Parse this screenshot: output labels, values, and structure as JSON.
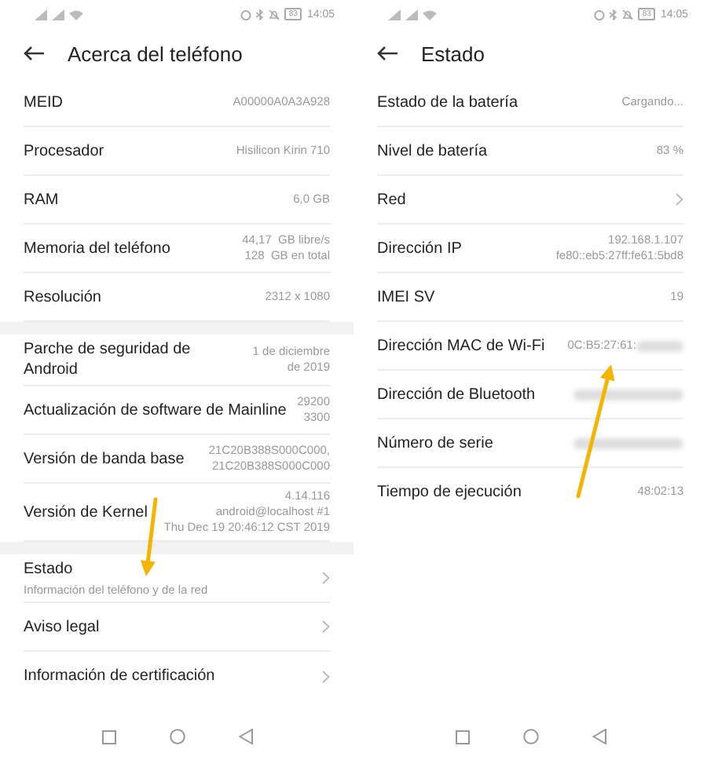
{
  "screens": [
    {
      "status_bar": {
        "battery": "83",
        "time": "14:05"
      },
      "title": "Acerca del teléfono",
      "arrow": true,
      "sections": [
        {
          "rows": [
            {
              "kind": "value",
              "label": "MEID",
              "value": "A00000A0A3A928"
            },
            {
              "kind": "value",
              "label": "Procesador",
              "value": "Hisilicon Kirin 710"
            },
            {
              "kind": "value",
              "label": "RAM",
              "value": "6,0 GB"
            },
            {
              "kind": "value",
              "label": "Memoria del teléfono",
              "value": "44,17  GB libre/s\n128  GB en total"
            },
            {
              "kind": "value",
              "label": "Resolución",
              "value": "2312 x 1080"
            }
          ]
        },
        {
          "rows": [
            {
              "kind": "value",
              "label": "Parche de seguridad de Android",
              "value": "1 de diciembre\nde 2019"
            },
            {
              "kind": "value",
              "label": "Actualización de software de Mainline",
              "value": "29200\n3300"
            },
            {
              "kind": "value",
              "label": "Versión de banda base",
              "value": "21C20B388S000C000,\n21C20B388S000C000"
            },
            {
              "kind": "value",
              "label": "Versión de Kernel",
              "value": "4.14.116\nandroid@localhost #1\nThu Dec 19 20:46:12 CST 2019"
            }
          ]
        },
        {
          "rows": [
            {
              "kind": "link",
              "label": "Estado",
              "sublabel": "Información del teléfono y de la red"
            },
            {
              "kind": "link",
              "label": "Aviso legal"
            },
            {
              "kind": "link",
              "label": "Información de certificación"
            }
          ]
        }
      ]
    },
    {
      "status_bar": {
        "battery": "83",
        "time": "14:05"
      },
      "title": "Estado",
      "arrow": true,
      "sections": [
        {
          "rows": [
            {
              "kind": "value",
              "label": "Estado de la batería",
              "value": "Cargando..."
            },
            {
              "kind": "value",
              "label": "Nivel de batería",
              "value": "83 %"
            },
            {
              "kind": "link",
              "label": "Red"
            },
            {
              "kind": "value",
              "label": "Dirección IP",
              "value": "192.168.1.107\nfe80::eb5:27ff:fe61:5bd8"
            },
            {
              "kind": "value",
              "label": "IMEI SV",
              "value": "19"
            },
            {
              "kind": "masked",
              "label": "Dirección MAC de Wi-Fi",
              "value": "0C:B5:27:61:"
            },
            {
              "kind": "masked",
              "label": "Dirección de Bluetooth"
            },
            {
              "kind": "masked",
              "label": "Número de serie"
            },
            {
              "kind": "value",
              "label": "Tiempo de ejecución",
              "value": "48:02:13"
            }
          ]
        }
      ]
    }
  ]
}
